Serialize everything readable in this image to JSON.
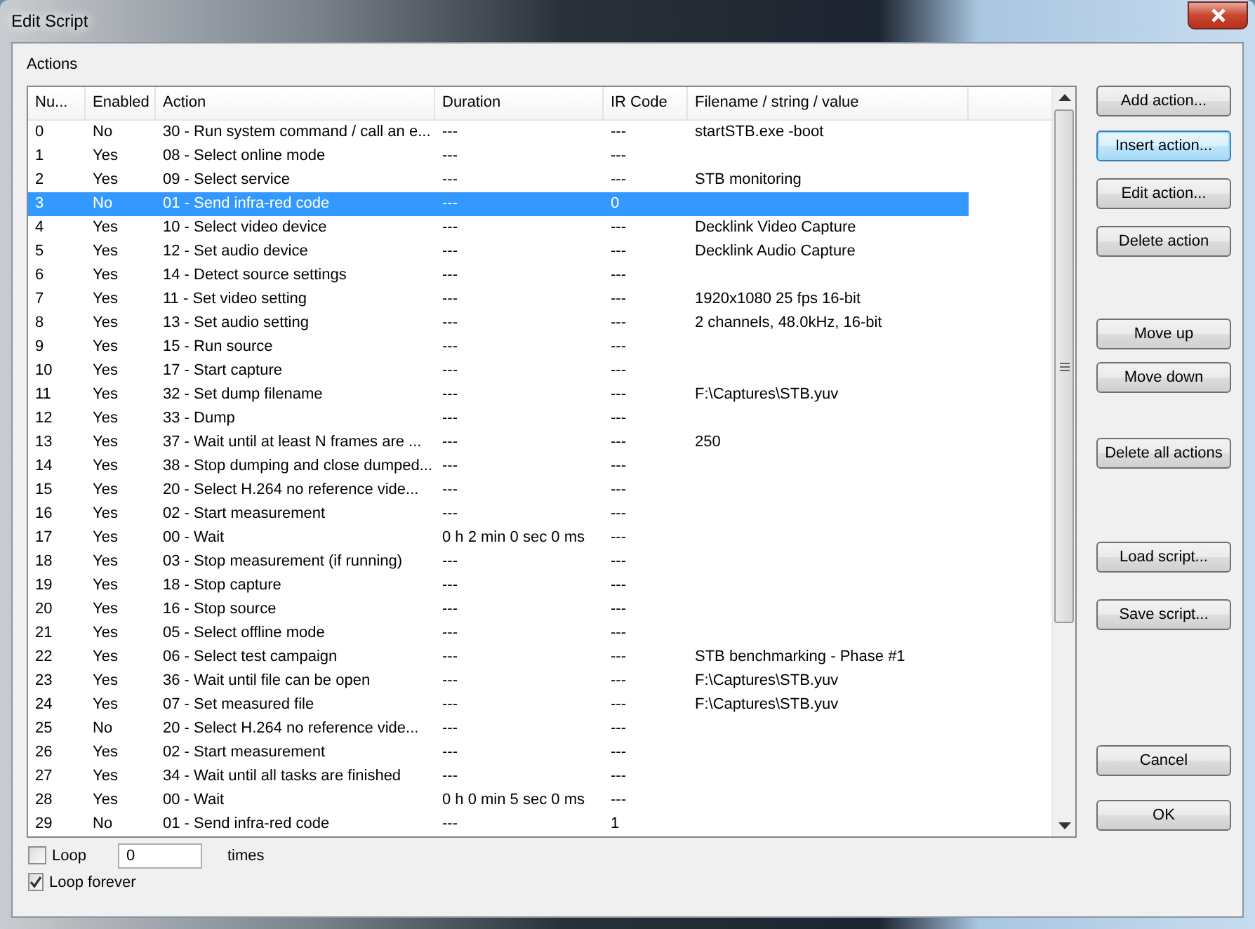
{
  "window": {
    "title": "Edit Script"
  },
  "group_label": "Actions",
  "table": {
    "columns": [
      "Nu...",
      "Enabled",
      "Action",
      "Duration",
      "IR Code",
      "Filename / string / value"
    ],
    "rows": [
      {
        "num": "0",
        "enabled": "No",
        "action": "30 - Run system command / call an e...",
        "duration": "---",
        "ir_code": "---",
        "value": "startSTB.exe -boot",
        "selected": false
      },
      {
        "num": "1",
        "enabled": "Yes",
        "action": "08 - Select online mode",
        "duration": "---",
        "ir_code": "---",
        "selected": false
      },
      {
        "num": "2",
        "enabled": "Yes",
        "action": "09 - Select service",
        "duration": "---",
        "ir_code": "---",
        "value": "STB monitoring",
        "selected": false
      },
      {
        "num": "3",
        "enabled": "No",
        "action": "01 - Send infra-red code",
        "duration": "---",
        "ir_code": "0",
        "selected": true
      },
      {
        "num": "4",
        "enabled": "Yes",
        "action": "10 - Select video device",
        "duration": "---",
        "ir_code": "---",
        "value": "Decklink Video Capture",
        "selected": false
      },
      {
        "num": "5",
        "enabled": "Yes",
        "action": "12 - Set audio device",
        "duration": "---",
        "ir_code": "---",
        "value": "Decklink Audio Capture",
        "selected": false
      },
      {
        "num": "6",
        "enabled": "Yes",
        "action": "14 - Detect source settings",
        "duration": "---",
        "ir_code": "---",
        "selected": false
      },
      {
        "num": "7",
        "enabled": "Yes",
        "action": "11 - Set video setting",
        "duration": "---",
        "ir_code": "---",
        "value": "1920x1080 25 fps 16-bit",
        "selected": false
      },
      {
        "num": "8",
        "enabled": "Yes",
        "action": "13 - Set audio setting",
        "duration": "---",
        "ir_code": "---",
        "value": "2 channels, 48.0kHz, 16-bit",
        "selected": false
      },
      {
        "num": "9",
        "enabled": "Yes",
        "action": "15 - Run source",
        "duration": "---",
        "ir_code": "---",
        "selected": false
      },
      {
        "num": "10",
        "enabled": "Yes",
        "action": "17 - Start capture",
        "duration": "---",
        "ir_code": "---",
        "selected": false
      },
      {
        "num": "11",
        "enabled": "Yes",
        "action": "32 - Set dump filename",
        "duration": "---",
        "ir_code": "---",
        "value": "F:\\Captures\\STB.yuv",
        "selected": false
      },
      {
        "num": "12",
        "enabled": "Yes",
        "action": "33 - Dump",
        "duration": "---",
        "ir_code": "---",
        "selected": false
      },
      {
        "num": "13",
        "enabled": "Yes",
        "action": "37 - Wait until at least N frames are ...",
        "duration": "---",
        "ir_code": "---",
        "value": "250",
        "selected": false
      },
      {
        "num": "14",
        "enabled": "Yes",
        "action": "38 - Stop dumping and close dumped...",
        "duration": "---",
        "ir_code": "---",
        "selected": false
      },
      {
        "num": "15",
        "enabled": "Yes",
        "action": "20 - Select H.264 no reference vide...",
        "duration": "---",
        "ir_code": "---",
        "selected": false
      },
      {
        "num": "16",
        "enabled": "Yes",
        "action": "02 - Start measurement",
        "duration": "---",
        "ir_code": "---",
        "selected": false
      },
      {
        "num": "17",
        "enabled": "Yes",
        "action": "00 - Wait",
        "duration": "0 h 2 min 0 sec 0 ms",
        "ir_code": "---",
        "selected": false
      },
      {
        "num": "18",
        "enabled": "Yes",
        "action": "03 - Stop measurement (if running)",
        "duration": "---",
        "ir_code": "---",
        "selected": false
      },
      {
        "num": "19",
        "enabled": "Yes",
        "action": "18 - Stop capture",
        "duration": "---",
        "ir_code": "---",
        "selected": false
      },
      {
        "num": "20",
        "enabled": "Yes",
        "action": "16 - Stop source",
        "duration": "---",
        "ir_code": "---",
        "selected": false
      },
      {
        "num": "21",
        "enabled": "Yes",
        "action": "05 - Select offline mode",
        "duration": "---",
        "ir_code": "---",
        "selected": false
      },
      {
        "num": "22",
        "enabled": "Yes",
        "action": "06 - Select test campaign",
        "duration": "---",
        "ir_code": "---",
        "value": "STB benchmarking - Phase #1",
        "selected": false
      },
      {
        "num": "23",
        "enabled": "Yes",
        "action": "36 - Wait until file can be open",
        "duration": "---",
        "ir_code": "---",
        "value": "F:\\Captures\\STB.yuv",
        "selected": false
      },
      {
        "num": "24",
        "enabled": "Yes",
        "action": "07 - Set measured file",
        "duration": "---",
        "ir_code": "---",
        "value": "F:\\Captures\\STB.yuv",
        "selected": false
      },
      {
        "num": "25",
        "enabled": "No",
        "action": "20 - Select H.264 no reference vide...",
        "duration": "---",
        "ir_code": "---",
        "selected": false
      },
      {
        "num": "26",
        "enabled": "Yes",
        "action": "02 - Start measurement",
        "duration": "---",
        "ir_code": "---",
        "selected": false
      },
      {
        "num": "27",
        "enabled": "Yes",
        "action": "34 - Wait until all tasks are finished",
        "duration": "---",
        "ir_code": "---",
        "selected": false
      },
      {
        "num": "28",
        "enabled": "Yes",
        "action": "00 - Wait",
        "duration": "0 h 0 min 5 sec 0 ms",
        "ir_code": "---",
        "selected": false
      },
      {
        "num": "29",
        "enabled": "No",
        "action": "01 - Send infra-red code",
        "duration": "---",
        "ir_code": "1",
        "selected": false
      }
    ]
  },
  "loop": {
    "label": "Loop",
    "checked": false,
    "count": "0",
    "unit": "times"
  },
  "loop_forever": {
    "label": "Loop forever",
    "checked": true
  },
  "button_groups": [
    [
      {
        "label": "Add action...",
        "default": false
      },
      {
        "label": "Insert action...",
        "default": true
      },
      {
        "label": "Edit action...",
        "default": false
      },
      {
        "label": "Delete action",
        "default": false
      }
    ],
    [
      {
        "label": "Move up",
        "default": false
      },
      {
        "label": "Move down",
        "default": false
      }
    ],
    [
      {
        "label": "Delete all actions",
        "default": false
      }
    ],
    [
      {
        "label": "Load script...",
        "default": false
      },
      {
        "label": "Save script...",
        "default": false
      }
    ],
    [
      {
        "label": "Cancel",
        "default": false
      },
      {
        "label": "OK",
        "default": false
      }
    ]
  ]
}
